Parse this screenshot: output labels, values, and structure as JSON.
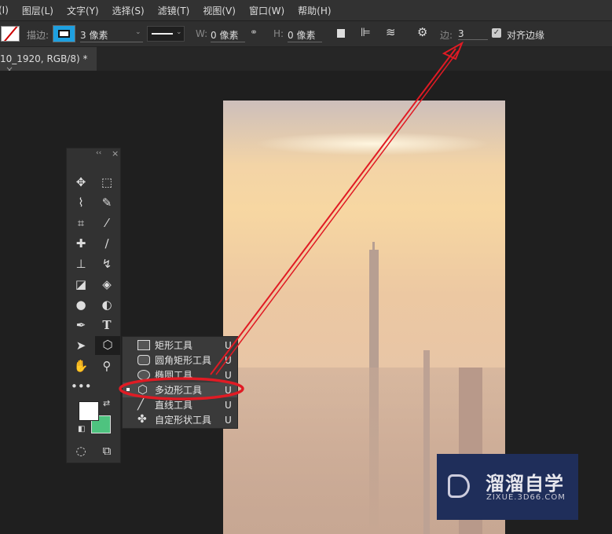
{
  "menu": [
    "(I)",
    "图层(L)",
    "文字(Y)",
    "选择(S)",
    "滤镜(T)",
    "视图(V)",
    "窗口(W)",
    "帮助(H)"
  ],
  "options": {
    "stroke_label": "描边:",
    "stroke_width": "3 像素",
    "w_label": "W:",
    "w_value": "0 像素",
    "h_label": "H:",
    "h_value": "0 像素",
    "sides_label": "边:",
    "sides_value": "3",
    "align_edges_label": "对齐边缘",
    "align_edges_checked": true,
    "stroke_color": "#1ea0e0"
  },
  "tab": {
    "title": "10_1920, RGB/8) *",
    "close": "×"
  },
  "toolbar": {
    "collapse": "‹‹",
    "close": "×",
    "foreground": "#ffffff",
    "background": "#4ec37f"
  },
  "flyout": [
    {
      "label": "矩形工具",
      "key": "U",
      "icon": "rectangle-icon"
    },
    {
      "label": "圆角矩形工具",
      "key": "U",
      "icon": "rounded-rectangle-icon"
    },
    {
      "label": "椭圆工具",
      "key": "U",
      "icon": "ellipse-icon"
    },
    {
      "label": "多边形工具",
      "key": "U",
      "icon": "polygon-icon",
      "selected": true
    },
    {
      "label": "直线工具",
      "key": "U",
      "icon": "line-icon"
    },
    {
      "label": "自定形状工具",
      "key": "U",
      "icon": "custom-shape-icon"
    }
  ],
  "watermark": {
    "name": "溜溜自学",
    "url": "ZIXUE.3D66.COM"
  },
  "annotation_color": "#e01b24"
}
